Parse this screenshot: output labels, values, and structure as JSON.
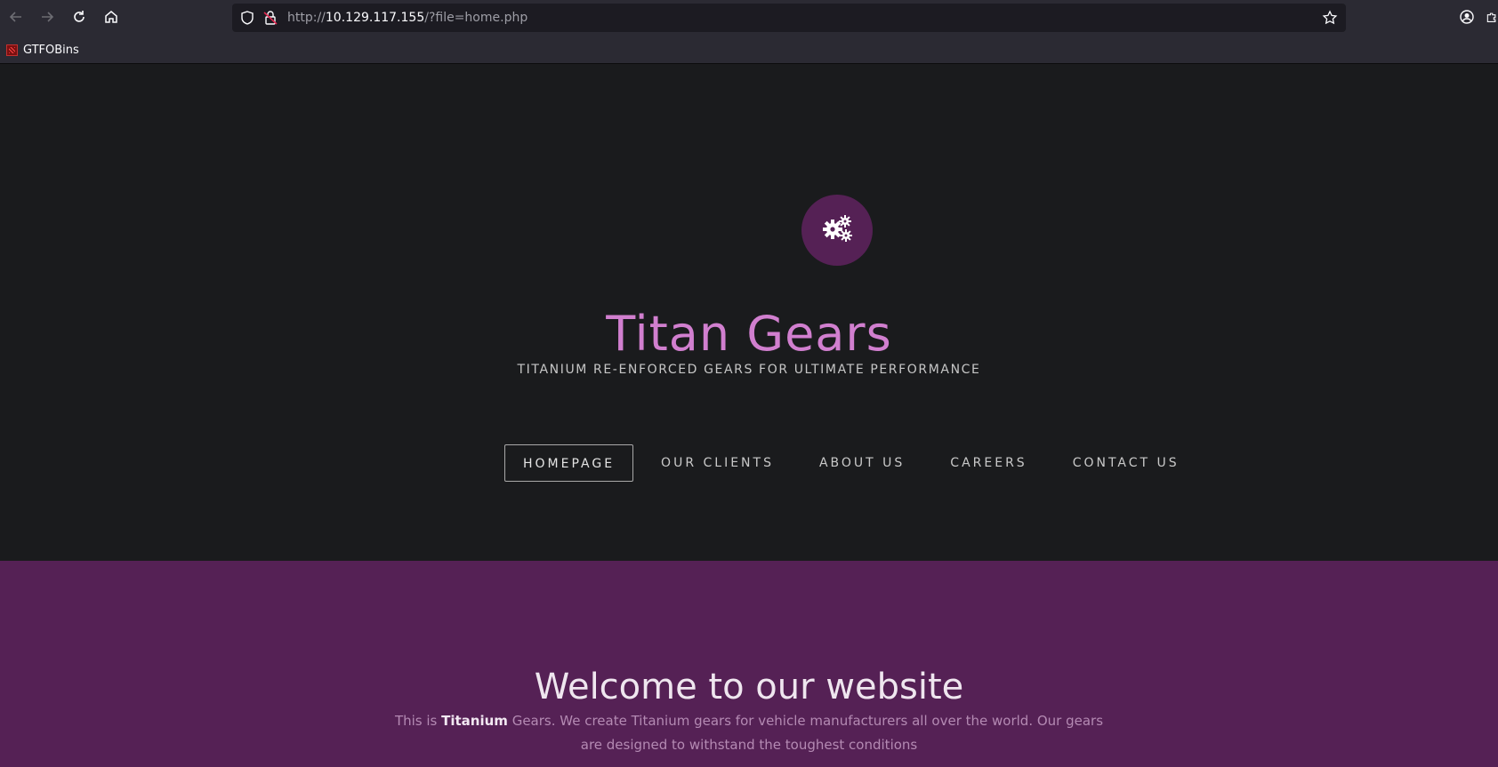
{
  "browser": {
    "url_scheme": "http://",
    "url_host": "10.129.117.155",
    "url_path": "/?file=home.php",
    "icons": [
      "back-icon",
      "forward-icon",
      "reload-icon",
      "home-icon",
      "shield-icon",
      "insecure-lock-icon",
      "star-icon",
      "account-icon",
      "extensions-icon"
    ],
    "bookmarks": [
      {
        "label": "GTFOBins",
        "icon": "gtfobins-favicon"
      }
    ]
  },
  "site": {
    "logo_icon": "gears-icon",
    "title": "Titan Gears",
    "tagline": "TITANIUM RE-ENFORCED GEARS FOR ULTIMATE PERFORMANCE",
    "nav": [
      {
        "label": "HOMEPAGE",
        "active": true
      },
      {
        "label": "OUR CLIENTS",
        "active": false
      },
      {
        "label": "ABOUT US",
        "active": false
      },
      {
        "label": "CAREERS",
        "active": false
      },
      {
        "label": "CONTACT US",
        "active": false
      }
    ]
  },
  "welcome": {
    "heading": "Welcome to our website",
    "text_before": "This is ",
    "text_bold": "Titanium",
    "text_after": " Gears. We create Titanium gears for vehicle manufacturers all over the world. Our gears are designed to withstand the toughest conditions"
  },
  "colors": {
    "page_bg": "#1a1b1d",
    "accent_purple": "#552155",
    "title_pink": "#d17fcf",
    "chrome_bg": "#2b2a33"
  }
}
